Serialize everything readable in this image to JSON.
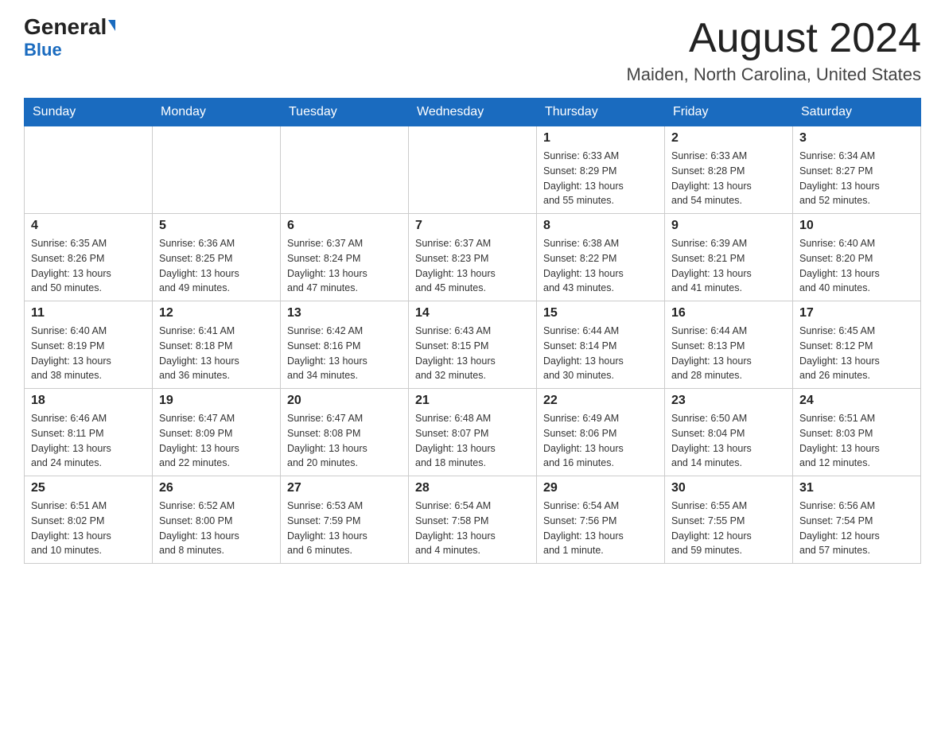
{
  "header": {
    "logo_main": "General",
    "logo_sub": "Blue",
    "month_title": "August 2024",
    "location": "Maiden, North Carolina, United States"
  },
  "days_of_week": [
    "Sunday",
    "Monday",
    "Tuesday",
    "Wednesday",
    "Thursday",
    "Friday",
    "Saturday"
  ],
  "weeks": [
    [
      {
        "day": "",
        "info": ""
      },
      {
        "day": "",
        "info": ""
      },
      {
        "day": "",
        "info": ""
      },
      {
        "day": "",
        "info": ""
      },
      {
        "day": "1",
        "info": "Sunrise: 6:33 AM\nSunset: 8:29 PM\nDaylight: 13 hours\nand 55 minutes."
      },
      {
        "day": "2",
        "info": "Sunrise: 6:33 AM\nSunset: 8:28 PM\nDaylight: 13 hours\nand 54 minutes."
      },
      {
        "day": "3",
        "info": "Sunrise: 6:34 AM\nSunset: 8:27 PM\nDaylight: 13 hours\nand 52 minutes."
      }
    ],
    [
      {
        "day": "4",
        "info": "Sunrise: 6:35 AM\nSunset: 8:26 PM\nDaylight: 13 hours\nand 50 minutes."
      },
      {
        "day": "5",
        "info": "Sunrise: 6:36 AM\nSunset: 8:25 PM\nDaylight: 13 hours\nand 49 minutes."
      },
      {
        "day": "6",
        "info": "Sunrise: 6:37 AM\nSunset: 8:24 PM\nDaylight: 13 hours\nand 47 minutes."
      },
      {
        "day": "7",
        "info": "Sunrise: 6:37 AM\nSunset: 8:23 PM\nDaylight: 13 hours\nand 45 minutes."
      },
      {
        "day": "8",
        "info": "Sunrise: 6:38 AM\nSunset: 8:22 PM\nDaylight: 13 hours\nand 43 minutes."
      },
      {
        "day": "9",
        "info": "Sunrise: 6:39 AM\nSunset: 8:21 PM\nDaylight: 13 hours\nand 41 minutes."
      },
      {
        "day": "10",
        "info": "Sunrise: 6:40 AM\nSunset: 8:20 PM\nDaylight: 13 hours\nand 40 minutes."
      }
    ],
    [
      {
        "day": "11",
        "info": "Sunrise: 6:40 AM\nSunset: 8:19 PM\nDaylight: 13 hours\nand 38 minutes."
      },
      {
        "day": "12",
        "info": "Sunrise: 6:41 AM\nSunset: 8:18 PM\nDaylight: 13 hours\nand 36 minutes."
      },
      {
        "day": "13",
        "info": "Sunrise: 6:42 AM\nSunset: 8:16 PM\nDaylight: 13 hours\nand 34 minutes."
      },
      {
        "day": "14",
        "info": "Sunrise: 6:43 AM\nSunset: 8:15 PM\nDaylight: 13 hours\nand 32 minutes."
      },
      {
        "day": "15",
        "info": "Sunrise: 6:44 AM\nSunset: 8:14 PM\nDaylight: 13 hours\nand 30 minutes."
      },
      {
        "day": "16",
        "info": "Sunrise: 6:44 AM\nSunset: 8:13 PM\nDaylight: 13 hours\nand 28 minutes."
      },
      {
        "day": "17",
        "info": "Sunrise: 6:45 AM\nSunset: 8:12 PM\nDaylight: 13 hours\nand 26 minutes."
      }
    ],
    [
      {
        "day": "18",
        "info": "Sunrise: 6:46 AM\nSunset: 8:11 PM\nDaylight: 13 hours\nand 24 minutes."
      },
      {
        "day": "19",
        "info": "Sunrise: 6:47 AM\nSunset: 8:09 PM\nDaylight: 13 hours\nand 22 minutes."
      },
      {
        "day": "20",
        "info": "Sunrise: 6:47 AM\nSunset: 8:08 PM\nDaylight: 13 hours\nand 20 minutes."
      },
      {
        "day": "21",
        "info": "Sunrise: 6:48 AM\nSunset: 8:07 PM\nDaylight: 13 hours\nand 18 minutes."
      },
      {
        "day": "22",
        "info": "Sunrise: 6:49 AM\nSunset: 8:06 PM\nDaylight: 13 hours\nand 16 minutes."
      },
      {
        "day": "23",
        "info": "Sunrise: 6:50 AM\nSunset: 8:04 PM\nDaylight: 13 hours\nand 14 minutes."
      },
      {
        "day": "24",
        "info": "Sunrise: 6:51 AM\nSunset: 8:03 PM\nDaylight: 13 hours\nand 12 minutes."
      }
    ],
    [
      {
        "day": "25",
        "info": "Sunrise: 6:51 AM\nSunset: 8:02 PM\nDaylight: 13 hours\nand 10 minutes."
      },
      {
        "day": "26",
        "info": "Sunrise: 6:52 AM\nSunset: 8:00 PM\nDaylight: 13 hours\nand 8 minutes."
      },
      {
        "day": "27",
        "info": "Sunrise: 6:53 AM\nSunset: 7:59 PM\nDaylight: 13 hours\nand 6 minutes."
      },
      {
        "day": "28",
        "info": "Sunrise: 6:54 AM\nSunset: 7:58 PM\nDaylight: 13 hours\nand 4 minutes."
      },
      {
        "day": "29",
        "info": "Sunrise: 6:54 AM\nSunset: 7:56 PM\nDaylight: 13 hours\nand 1 minute."
      },
      {
        "day": "30",
        "info": "Sunrise: 6:55 AM\nSunset: 7:55 PM\nDaylight: 12 hours\nand 59 minutes."
      },
      {
        "day": "31",
        "info": "Sunrise: 6:56 AM\nSunset: 7:54 PM\nDaylight: 12 hours\nand 57 minutes."
      }
    ]
  ]
}
